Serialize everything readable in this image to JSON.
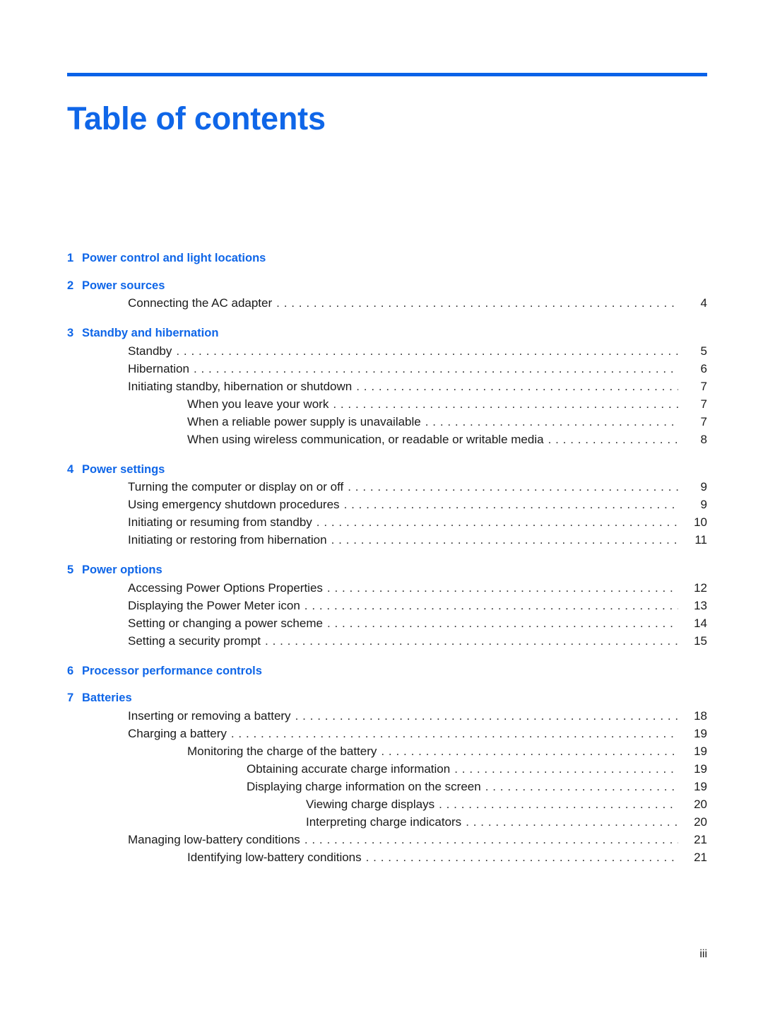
{
  "document": {
    "title": "Table of contents",
    "footer_page_number": "iii",
    "accent_color": "#0f66e8",
    "rule_color": "#0a62e8",
    "body_text_color": "#1a1a1a"
  },
  "chapters": [
    {
      "number": "1",
      "title": "Power control and light locations",
      "entries": []
    },
    {
      "number": "2",
      "title": "Power sources",
      "entries": [
        {
          "level": 1,
          "label": "Connecting the AC adapter",
          "page": "4"
        }
      ]
    },
    {
      "number": "3",
      "title": "Standby and hibernation",
      "entries": [
        {
          "level": 1,
          "label": "Standby",
          "page": "5"
        },
        {
          "level": 1,
          "label": "Hibernation",
          "page": "6"
        },
        {
          "level": 1,
          "label": "Initiating standby, hibernation or shutdown",
          "page": "7"
        },
        {
          "level": 2,
          "label": "When you leave your work",
          "page": "7"
        },
        {
          "level": 2,
          "label": "When a reliable power supply is unavailable",
          "page": "7"
        },
        {
          "level": 2,
          "label": "When using wireless communication, or readable or writable media",
          "page": "8"
        }
      ]
    },
    {
      "number": "4",
      "title": "Power settings",
      "entries": [
        {
          "level": 1,
          "label": "Turning the computer or display on or off",
          "page": "9"
        },
        {
          "level": 1,
          "label": "Using emergency shutdown procedures",
          "page": "9"
        },
        {
          "level": 1,
          "label": "Initiating or resuming from standby",
          "page": "10"
        },
        {
          "level": 1,
          "label": "Initiating or restoring from hibernation",
          "page": "11"
        }
      ]
    },
    {
      "number": "5",
      "title": "Power options",
      "entries": [
        {
          "level": 1,
          "label": "Accessing Power Options Properties",
          "page": "12"
        },
        {
          "level": 1,
          "label": "Displaying the Power Meter icon",
          "page": "13"
        },
        {
          "level": 1,
          "label": "Setting or changing a power scheme",
          "page": "14"
        },
        {
          "level": 1,
          "label": "Setting a security prompt",
          "page": "15"
        }
      ]
    },
    {
      "number": "6",
      "title": "Processor performance controls",
      "entries": []
    },
    {
      "number": "7",
      "title": "Batteries",
      "entries": [
        {
          "level": 1,
          "label": "Inserting or removing a battery",
          "page": "18"
        },
        {
          "level": 1,
          "label": "Charging a battery",
          "page": "19"
        },
        {
          "level": 2,
          "label": "Monitoring the charge of the battery",
          "page": "19"
        },
        {
          "level": 3,
          "label": "Obtaining accurate charge information",
          "page": "19"
        },
        {
          "level": 3,
          "label": "Displaying charge information on the screen",
          "page": "19"
        },
        {
          "level": 3,
          "label": "Viewing charge displays",
          "page": "20",
          "extra_indent": true
        },
        {
          "level": 3,
          "label": "Interpreting charge indicators",
          "page": "20",
          "extra_indent": true
        },
        {
          "level": 1,
          "label": "Managing low-battery conditions",
          "page": "21"
        },
        {
          "level": 2,
          "label": "Identifying low-battery conditions",
          "page": "21"
        }
      ]
    }
  ]
}
